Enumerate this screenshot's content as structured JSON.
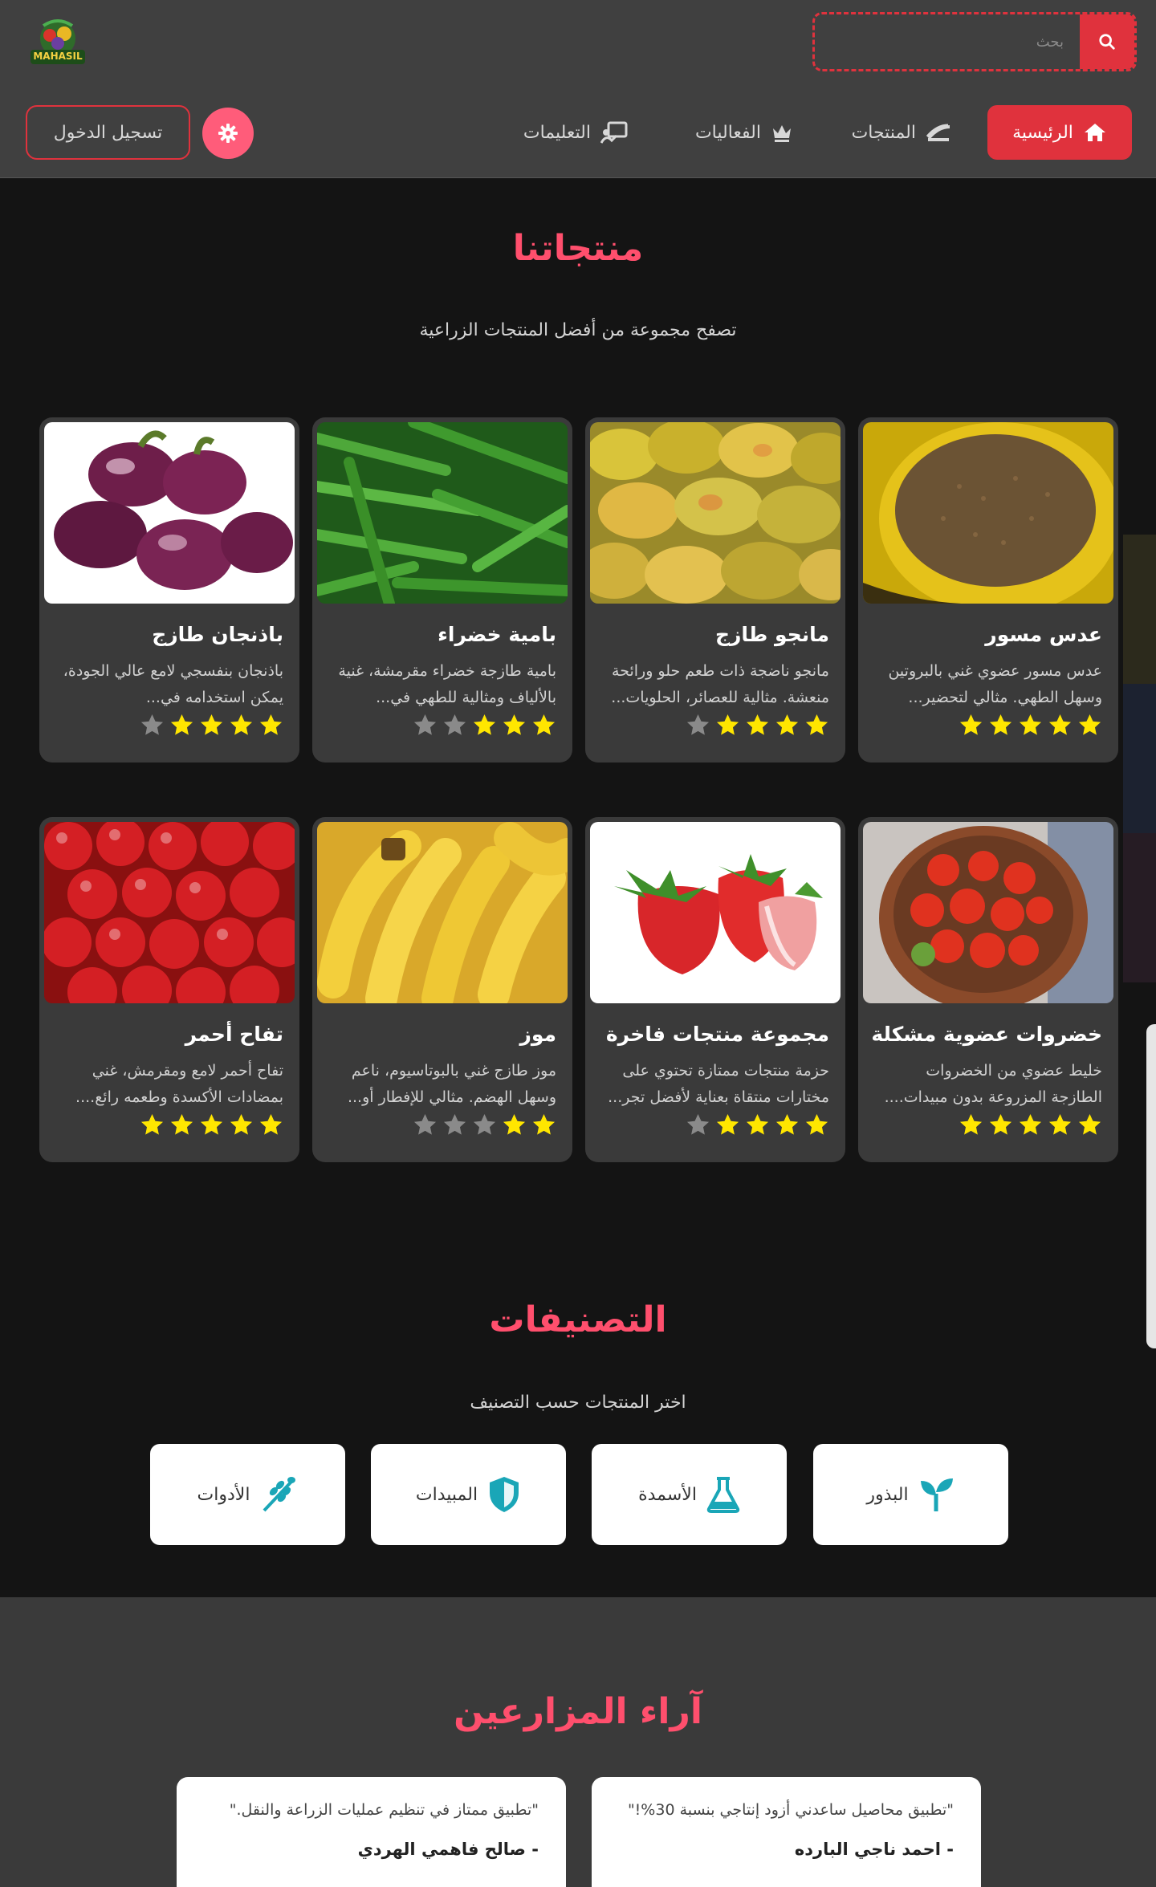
{
  "header": {
    "logo_text": "MAHASIL",
    "search_placeholder": "بحث",
    "nav": {
      "home": "الرئيسية",
      "products": "المنتجات",
      "events": "الفعاليات",
      "tutorials": "التعليمات"
    },
    "login": "تسجيل الدخول"
  },
  "products_section": {
    "title": "منتجاتنا",
    "subtitle": "تصفح مجموعة من أفضل المنتجات الزراعية",
    "items": [
      {
        "title": "عدس مسور",
        "desc": "عدس مسور عضوي غني بالبروتين وسهل الطهي. مثالي لتحضير...",
        "rating": 5,
        "image": "lentils"
      },
      {
        "title": "مانجو طازج",
        "desc": "مانجو ناضجة ذات طعم حلو ورائحة منعشة. مثالية للعصائر، الحلويات...",
        "rating": 4,
        "image": "mango"
      },
      {
        "title": "بامية خضراء",
        "desc": "بامية طازجة خضراء مقرمشة، غنية بالألياف ومثالية للطهي في...",
        "rating": 3,
        "image": "okra"
      },
      {
        "title": "باذنجان طازج",
        "desc": "باذنجان بنفسجي لامع عالي الجودة، يمكن استخدامه في...",
        "rating": 4,
        "image": "eggplant"
      },
      {
        "title": "خضروات عضوية مشكلة",
        "desc": "خليط عضوي من الخضروات الطازجة المزروعة بدون مبيدات....",
        "rating": 5,
        "image": "tomatoes"
      },
      {
        "title": "مجموعة منتجات فاخرة",
        "desc": "حزمة منتجات ممتازة تحتوي على مختارات منتقاة بعناية لأفضل تجر...",
        "rating": 4,
        "image": "strawberry"
      },
      {
        "title": "موز",
        "desc": "موز طازج غني بالبوتاسيوم، ناعم وسهل الهضم. مثالي للإفطار أو...",
        "rating": 2,
        "image": "banana"
      },
      {
        "title": "تفاح أحمر",
        "desc": "تفاح أحمر لامع ومقرمش، غني بمضادات الأكسدة وطعمه رائع....",
        "rating": 5,
        "image": "apple"
      }
    ]
  },
  "categories_section": {
    "title": "التصنيفات",
    "subtitle": "اختر المنتجات حسب التصنيف",
    "items": [
      {
        "label": "البذور",
        "icon": "seedling-icon"
      },
      {
        "label": "الأسمدة",
        "icon": "flask-icon"
      },
      {
        "label": "المبيدات",
        "icon": "shield-icon"
      },
      {
        "label": "الأدوات",
        "icon": "wheat-tool-icon"
      }
    ]
  },
  "testimonials_section": {
    "title": "آراء المزارعين",
    "items": [
      {
        "quote": "\"تطبيق محاصيل ساعدني أزود إنتاجي بنسبة 30%!\"",
        "author": "- احمد ناجي البارده"
      },
      {
        "quote": "\"تطبيق ممتاز في تنظيم عمليات الزراعة والنقل.\"",
        "author": "- صالح فاهمي الهردي"
      }
    ]
  },
  "colors": {
    "accent": "#e0323d",
    "title": "#ff4f6d",
    "star_on": "#ffe600",
    "star_off": "#8a8a8a",
    "category_icon": "#1aa6b7"
  }
}
